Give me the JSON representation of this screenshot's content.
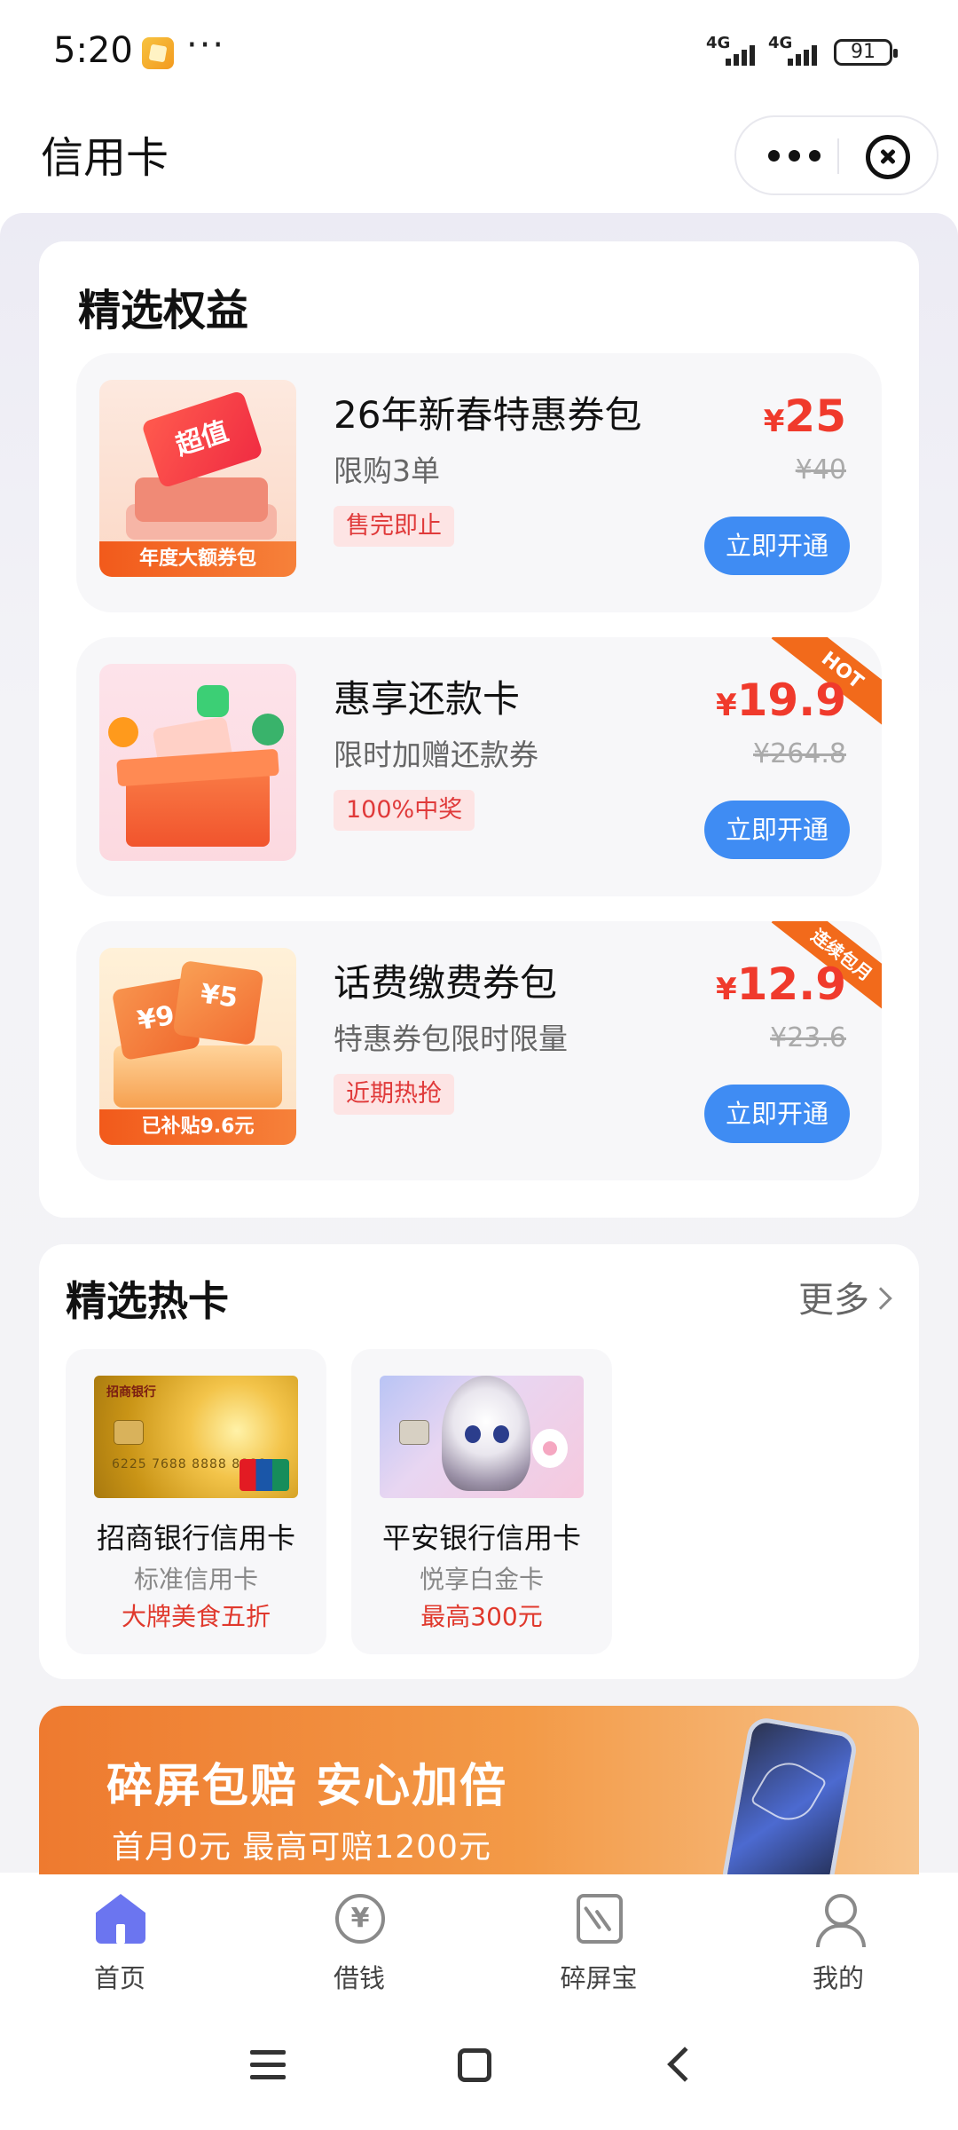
{
  "status_bar": {
    "time": "5:20",
    "dots": "···",
    "signal1_label": "4G",
    "signal2_label": "4G",
    "battery": "91"
  },
  "header": {
    "title": "信用卡"
  },
  "benefits": {
    "title": "精选权益",
    "items": [
      {
        "name": "26年新春特惠券包",
        "subtitle": "限购3单",
        "tag": "售完即止",
        "currency": "¥",
        "price": "25",
        "original_price": "¥40",
        "button": "立即开通",
        "thumb_badge": "超值",
        "thumb_band": "年度大额券包",
        "ribbon": ""
      },
      {
        "name": "惠享还款卡",
        "subtitle": "限时加赠还款券",
        "tag": "100%中奖",
        "currency": "¥",
        "price": "19.9",
        "original_price": "¥264.8",
        "button": "立即开通",
        "ribbon": "HOT"
      },
      {
        "name": "话费缴费券包",
        "subtitle": "特惠券包限时限量",
        "tag": "近期热抢",
        "currency": "¥",
        "price": "12.9",
        "original_price": "¥23.6",
        "button": "立即开通",
        "thumb_band": "已补贴9.6元",
        "ribbon": "连续包月"
      }
    ]
  },
  "hot_cards": {
    "title": "精选热卡",
    "more": "更多",
    "cards": [
      {
        "name": "招商银行信用卡",
        "type": "标准信用卡",
        "perk": "大牌美食五折",
        "card_logo": "招商银行",
        "card_number": "6225 7688 8888 8888"
      },
      {
        "name": "平安银行信用卡",
        "type": "悦享白金卡",
        "perk": "最高300元"
      }
    ]
  },
  "banner": {
    "title": "碎屏包赔 安心加倍",
    "subtitle": "首月0元 最高可赔1200元"
  },
  "tabbar": {
    "tabs": [
      {
        "label": "首页",
        "icon": "home-icon",
        "active": true
      },
      {
        "label": "借钱",
        "icon": "yuan-circle-icon",
        "active": false
      },
      {
        "label": "碎屏宝",
        "icon": "cracked-screen-icon",
        "active": false
      },
      {
        "label": "我的",
        "icon": "user-icon",
        "active": false
      }
    ],
    "icon_glyph_borrow": "¥"
  },
  "colors": {
    "accent_blue": "#3f8cf3",
    "price_red": "#f03a2c",
    "tab_active": "#6b75f0",
    "ribbon_orange": "#f26a1b"
  }
}
